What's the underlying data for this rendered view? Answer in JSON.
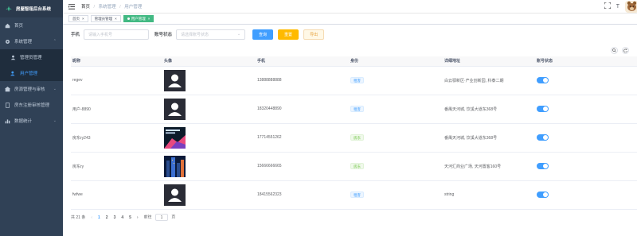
{
  "app": {
    "title": "房屋智租后台系统"
  },
  "sidebar": {
    "items": [
      {
        "label": "首页",
        "icon": "home-icon"
      },
      {
        "label": "系统管理",
        "icon": "gear-icon",
        "expanded": true,
        "children": [
          {
            "label": "管理员管理",
            "icon": "user-icon",
            "active": false
          },
          {
            "label": "用户管理",
            "icon": "users-icon",
            "active": true
          }
        ]
      },
      {
        "label": "房源管理与审核",
        "icon": "house-icon"
      },
      {
        "label": "房东注册审核管理",
        "icon": "doc-icon"
      },
      {
        "label": "数据统计",
        "icon": "chart-icon"
      }
    ]
  },
  "header": {
    "breadcrumb": [
      "首页",
      "系统管理",
      "用户管理"
    ],
    "font_size_label": "T"
  },
  "tags": [
    {
      "label": "首页",
      "active": false
    },
    {
      "label": "管理员管理",
      "active": false
    },
    {
      "label": "用户管理",
      "active": true
    }
  ],
  "filters": {
    "phone_label": "手机",
    "phone_placeholder": "请输入手机号",
    "status_label": "账号状态",
    "status_placeholder": "请选择账号状态",
    "search_btn": "查询",
    "reset_btn": "重置",
    "export_btn": "导出"
  },
  "table": {
    "headers": [
      "昵称",
      "头像",
      "手机",
      "身份",
      "详细地址",
      "账号状态"
    ],
    "rows": [
      {
        "name": "regev",
        "avatar": "default",
        "phone": "13888888888",
        "role": "租客",
        "role_color": "blue",
        "address": "白云鄂新区·产业创新园, 科泰二期",
        "enabled": true
      },
      {
        "name": "用户-8890",
        "avatar": "default",
        "phone": "18320448890",
        "role": "租客",
        "role_color": "blue",
        "address": "番禺天河城, 饮溪大道东368号",
        "enabled": true
      },
      {
        "name": "房东ry243",
        "avatar": "book",
        "phone": "17714551262",
        "role": "房东",
        "role_color": "green",
        "address": "番禺天河城, 饮溪大道东368号",
        "enabled": true
      },
      {
        "name": "房东ry",
        "avatar": "city",
        "phone": "15666666665",
        "role": "房东",
        "role_color": "green",
        "address": "天河汇商业广场, 天河置客160号",
        "enabled": true
      },
      {
        "name": "fwfwe",
        "avatar": "default",
        "phone": "18415562323",
        "role": "租客",
        "role_color": "blue",
        "address": "string",
        "enabled": true
      }
    ]
  },
  "pagination": {
    "total_label": "共 21 条",
    "pages": [
      "1",
      "2",
      "3",
      "4",
      "5"
    ],
    "current": "1",
    "goto_label": "前往",
    "goto_value": "1",
    "page_suffix": "页"
  },
  "colors": {
    "sidebar_bg": "#304156",
    "primary": "#409eff",
    "warning": "#ffba00",
    "success_tag": "#42b983"
  }
}
